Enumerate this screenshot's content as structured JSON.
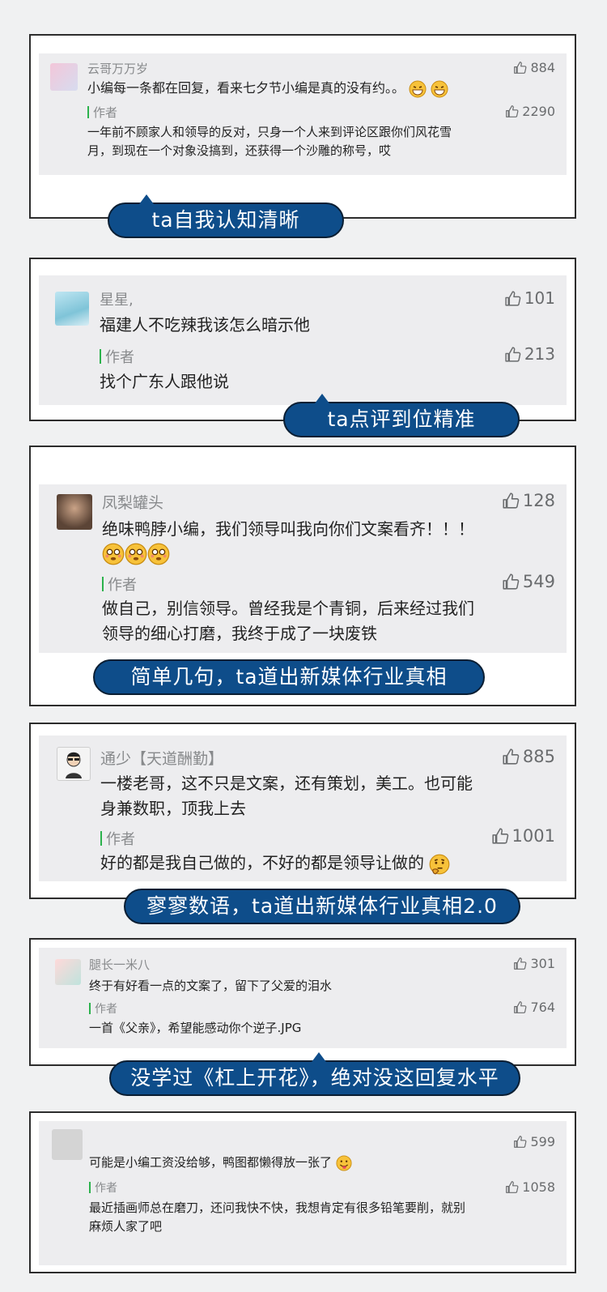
{
  "colors": {
    "bubble": "#0e4d8a",
    "author_bar": "#2bb24c",
    "panel": "#ededef"
  },
  "cards": [
    {
      "username": "云哥万万岁",
      "likes": "884",
      "comment": "小编每一条都在回复，看来七夕节小编是真的没有约。。",
      "author_label": "作者",
      "author_likes": "2290",
      "reply_line1": "一年前不顾家人和领导的反对，只身一个人来到评论区跟你们风花雪",
      "reply_line2": "月，到现在一个对象没搞到，还获得一个沙雕的称号，哎",
      "caption": "ta自我认知清晰"
    },
    {
      "username": "星星,",
      "likes": "101",
      "comment": "福建人不吃辣我该怎么暗示他",
      "author_label": "作者",
      "author_likes": "213",
      "reply_line1": "找个广东人跟他说",
      "caption": "ta点评到位精准"
    },
    {
      "username": "凤梨罐头",
      "likes": "128",
      "comment": "绝味鸭脖小编，我们领导叫我向你们文案看齐！！！",
      "author_label": "作者",
      "author_likes": "549",
      "reply_line1": "做自己，别信领导。曾经我是个青铜，后来经过我们",
      "reply_line2": "领导的细心打磨，我终于成了一块废铁",
      "caption": "简单几句，ta道出新媒体行业真相"
    },
    {
      "username": "通少【天道酬勤】",
      "likes": "885",
      "comment_line1": "一楼老哥，这不只是文案，还有策划，美工。也可能",
      "comment_line2": "身兼数职，顶我上去",
      "author_label": "作者",
      "author_likes": "1001",
      "reply_line1": "好的都是我自己做的，不好的都是领导让做的",
      "caption": "寥寥数语，ta道出新媒体行业真相2.0"
    },
    {
      "username": "腿长一米八",
      "likes": "301",
      "comment": "终于有好看一点的文案了，留下了父爱的泪水",
      "author_label": "作者",
      "author_likes": "764",
      "reply_line1": "一首《父亲》，希望能感动你个逆子.JPG",
      "caption": "没学过《杠上开花》，绝对没这回复水平"
    },
    {
      "username": "",
      "likes": "599",
      "comment": "可能是小编工资没给够，鸭图都懒得放一张了",
      "author_label": "作者",
      "author_likes": "1058",
      "reply_line1": "最近插画师总在磨刀，还问我快不快，我想肯定有很多铅笔要削，就别",
      "reply_line2": "麻烦人家了吧"
    }
  ]
}
